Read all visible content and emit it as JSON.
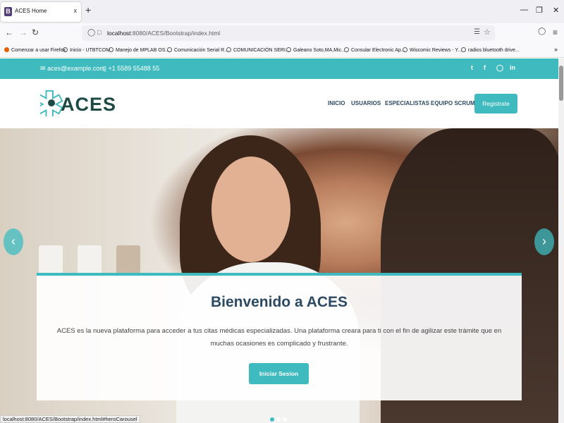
{
  "browser": {
    "tab_title": "ACES Home",
    "tab_favicon": "B",
    "tab_close": "x",
    "new_tab": "+",
    "url_host": "localhost",
    "url_path": ":8080/ACES/Bootstrap/index.html",
    "status_url": "localhost:8080/ACES/Bootstrap/index.html#heroCarousel",
    "bookmarks": [
      "Comenzar a usar Firefox",
      "Inicio - UTBTCOM",
      "Manejo de MPLAB OS...",
      "Comunicación Serial R...",
      "COMUNICACIÓN SERI...",
      "Galeano Soto,MA,Mic...",
      "Consular Electronic Ap...",
      "Wiscomic Reviews - Y...",
      "radios bluetooth drive..."
    ]
  },
  "topbar": {
    "email": "aces@example.com",
    "phone": "+1 5589 55488 55",
    "social": [
      "twitter-icon",
      "facebook-icon",
      "instagram-icon",
      "linkedin-icon"
    ]
  },
  "header": {
    "logo_text": "ACES",
    "menu": [
      "INICIO",
      "USUARIOS",
      "ESPECIALISTAS",
      "EQUIPO SCRUM"
    ],
    "register": "Registrate"
  },
  "hero": {
    "title": "Bienvenido a ACES",
    "description": "ACES es la nueva plataforma para acceder a tus citas médicas especializadas. Una plataforma creara para ti con el fin de agilizar este trámite que en muchas ocasiones es complicado y frustrante.",
    "button": "Iniciar Sesion",
    "slides": 3,
    "active_slide": 1
  },
  "colors": {
    "accent": "#3fbbc0",
    "heading": "#2c4964",
    "logo": "#1d4a45"
  }
}
